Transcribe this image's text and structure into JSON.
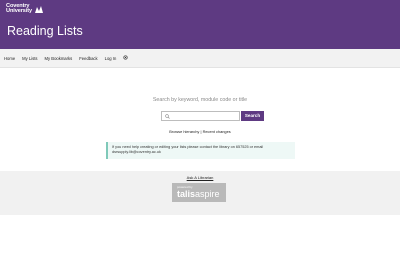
{
  "header": {
    "logo_line1": "Coventry",
    "logo_line2": "University",
    "title": "Reading Lists"
  },
  "nav": {
    "items": [
      "Home",
      "My Lists",
      "My Bookmarks",
      "Feedback",
      "Log In"
    ],
    "settings_icon": "gear-icon"
  },
  "search": {
    "heading": "Search by keyword, module code or title",
    "placeholder": "",
    "value": "",
    "button_label": "Search",
    "icon": "search-icon"
  },
  "browse": {
    "hierarchy_label": "Browse hierarchy",
    "separator": "|",
    "recent_label": "Recent changes"
  },
  "help": {
    "text": "If you need help creating or editing your lists please contact the library on 657525 or email",
    "email": "dsrsupply.lib@coventry.ac.uk"
  },
  "footer": {
    "ask_link": "Ask A Librarian",
    "badge_small": "powered by",
    "badge_talis": "talis",
    "badge_aspire": "aspire"
  },
  "colors": {
    "brand": "#5e3a82",
    "help_bg": "#eef8f6",
    "help_border": "#7fc9b9",
    "footer_bg": "#f1f1f1"
  }
}
